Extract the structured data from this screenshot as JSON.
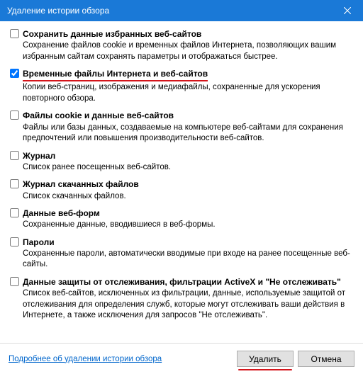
{
  "window": {
    "title": "Удаление истории обзора"
  },
  "options": [
    {
      "checked": false,
      "label": "Сохранить данные избранных веб-сайтов",
      "desc": "Сохранение файлов cookie и временных файлов Интернета, позволяющих вашим избранным сайтам сохранять параметры и отображаться быстрее.",
      "highlight": false
    },
    {
      "checked": true,
      "label": "Временные файлы Интернета и веб-сайтов",
      "desc": "Копии веб-страниц, изображения и медиафайлы, сохраненные для ускорения повторного обзора.",
      "highlight": true
    },
    {
      "checked": false,
      "label": "Файлы cookie и данные веб-сайтов",
      "desc": "Файлы или базы данных, создаваемые на компьютере веб-сайтами для сохранения предпочтений или повышения производительности веб-сайтов.",
      "highlight": false
    },
    {
      "checked": false,
      "label": "Журнал",
      "desc": "Список ранее посещенных веб-сайтов.",
      "highlight": false
    },
    {
      "checked": false,
      "label": "Журнал скачанных файлов",
      "desc": "Список скачанных файлов.",
      "highlight": false
    },
    {
      "checked": false,
      "label": "Данные веб-форм",
      "desc": "Сохраненные данные, вводившиеся в веб-формы.",
      "highlight": false
    },
    {
      "checked": false,
      "label": "Пароли",
      "desc": "Сохраненные пароли, автоматически вводимые при входе на ранее посещенные веб-сайты.",
      "highlight": false
    },
    {
      "checked": false,
      "label": "Данные защиты от отслеживания, фильтрации ActiveX и \"Не отслеживать\"",
      "desc": "Список веб-сайтов, исключенных из фильтрации, данные, используемые защитой от отслеживания для определения служб, которые могут отслеживать ваши действия в Интернете, а также исключения для запросов \"Не отслеживать\".",
      "highlight": false
    }
  ],
  "footer": {
    "help_link": "Подробнее об удалении истории обзора",
    "delete_button": "Удалить",
    "cancel_button": "Отмена"
  }
}
